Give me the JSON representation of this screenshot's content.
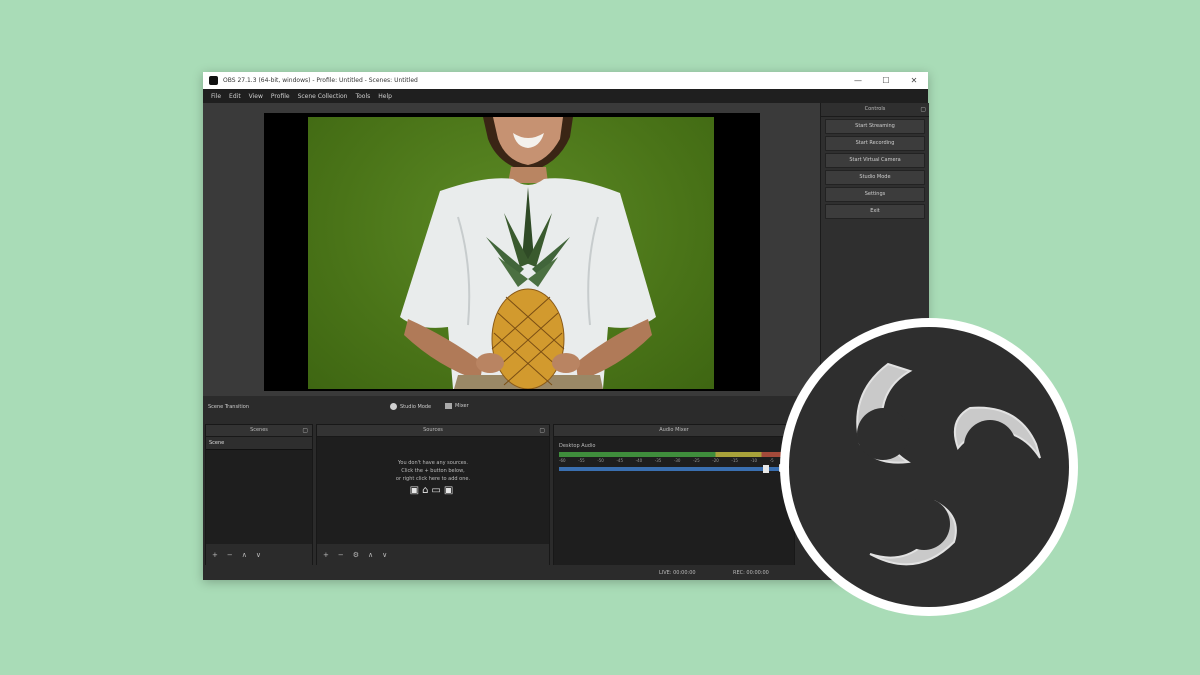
{
  "window": {
    "title": "OBS 27.1.3 (64-bit, windows) - Profile: Untitled - Scenes: Untitled",
    "controls": {
      "minimize": "—",
      "maximize": "☐",
      "close": "✕"
    }
  },
  "menu": [
    "File",
    "Edit",
    "View",
    "Profile",
    "Scene Collection",
    "Tools",
    "Help"
  ],
  "controls_dock": {
    "title": "Controls",
    "buttons": [
      "Start Streaming",
      "Start Recording",
      "Start Virtual Camera",
      "Studio Mode",
      "Settings",
      "Exit"
    ]
  },
  "transition_bar": {
    "scene_label": "Scene Transition",
    "studio_label": "Studio Mode",
    "mixer_label": "Mixer"
  },
  "docks": {
    "scenes": {
      "title": "Scenes",
      "items": [
        "Scene"
      ]
    },
    "sources": {
      "title": "Sources",
      "hint_lines": [
        "You don't have any sources.",
        "Click the + button below,",
        "or right click here to add one."
      ],
      "hint_icons": "▣⌂▭▣"
    },
    "mixer": {
      "title": "Audio Mixer",
      "track_label": "Desktop Audio",
      "ticks": [
        "-60",
        "-55",
        "-50",
        "-45",
        "-40",
        "-35",
        "-30",
        "-25",
        "-20",
        "-15",
        "-10",
        "-5",
        "0"
      ]
    }
  },
  "footer_icons": {
    "add": "+",
    "remove": "−",
    "settings": "⚙",
    "up": "∧",
    "down": "∨"
  },
  "status": {
    "live": "LIVE: 00:00:00",
    "rec": "REC: 00:00:00"
  },
  "colors": {
    "background": "#a9dcb7",
    "obs_dark": "#2b2b2b",
    "logo_ring": "#ffffff",
    "logo_inner": "#2e2e2e"
  }
}
